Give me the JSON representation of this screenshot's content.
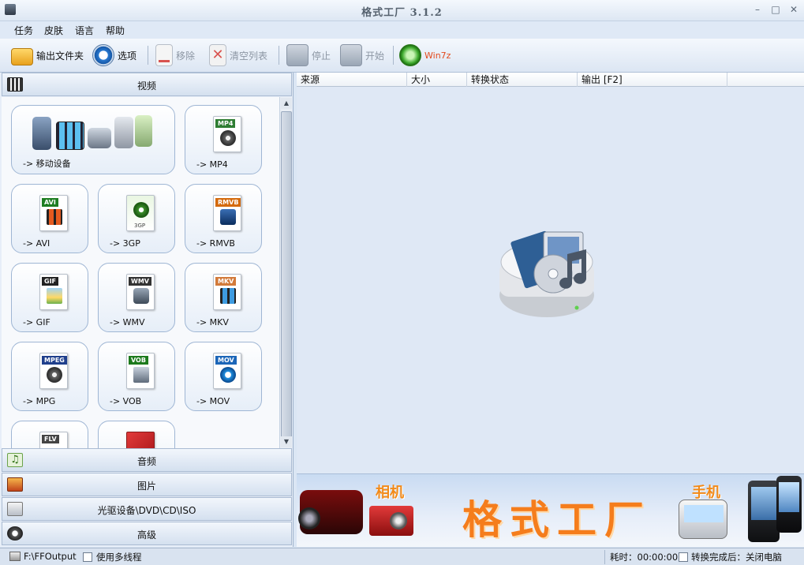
{
  "window": {
    "title": "格式工厂 3.1.2",
    "min": "–",
    "max": "□",
    "close": "✕"
  },
  "menu": [
    "任务",
    "皮肤",
    "语言",
    "帮助"
  ],
  "toolbar": {
    "output_folder": "输出文件夹",
    "options": "选项",
    "remove": "移除",
    "clear_list": "清空列表",
    "stop": "停止",
    "start": "开始",
    "win7z": "Win7z"
  },
  "categories": {
    "video": "视频",
    "audio": "音频",
    "picture": "图片",
    "rom": "光驱设备\\DVD\\CD\\ISO",
    "advanced": "高级"
  },
  "tiles": [
    {
      "label": "-> 移动设备",
      "badge": ""
    },
    {
      "label": "-> MP4",
      "badge": "MP4",
      "color": "#2e7d32"
    },
    {
      "label": "-> AVI",
      "badge": "AVI",
      "color": "#1e7d22"
    },
    {
      "label": "-> 3GP",
      "badge": "3GP",
      "color": "#3a8f2a"
    },
    {
      "label": "-> RMVB",
      "badge": "RMVB",
      "color": "#d46a0d"
    },
    {
      "label": "-> GIF",
      "badge": "GIF",
      "color": "#222222"
    },
    {
      "label": "-> WMV",
      "badge": "WMV",
      "color": "#333333"
    },
    {
      "label": "-> MKV",
      "badge": "MKV",
      "color": "#d27a3a"
    },
    {
      "label": "-> MPG",
      "badge": "MPEG",
      "color": "#1f3f8c"
    },
    {
      "label": "-> VOB",
      "badge": "VOB",
      "color": "#1d7a1d"
    },
    {
      "label": "-> MOV",
      "badge": "MOV",
      "color": "#1c66b8"
    },
    {
      "label": "",
      "badge": "FLV",
      "color": "#444444"
    },
    {
      "label": "",
      "badge": "",
      "color": "#c8202b"
    }
  ],
  "columns": [
    "来源",
    "大小",
    "转换状态",
    "输出 [F2]"
  ],
  "banner": {
    "title": "格式工厂",
    "camera": "相机",
    "phone": "手机"
  },
  "status": {
    "output_path": "F:\\FFOutput",
    "multithread": "使用多线程",
    "elapsed": "耗时：00:00:00",
    "after_done": "转换完成后：关闭电脑"
  }
}
